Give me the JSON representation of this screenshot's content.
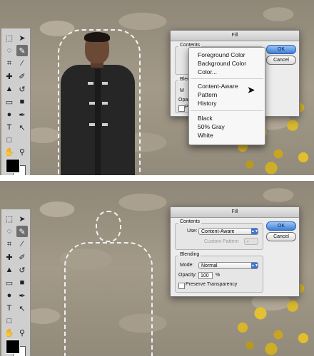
{
  "dialog": {
    "title": "Fill",
    "contents_label": "Contents",
    "use_label": "Use:",
    "use_value": "Content-Aware",
    "custom_pattern_label": "Custom Pattern",
    "blending_label": "Blending",
    "mode_label": "Mode:",
    "mode_value": "Normal",
    "opacity_label": "Opacity:",
    "opacity_value": "100",
    "opacity_unit": "%",
    "preserve_label": "Preserve Transparency",
    "ok_label": "OK",
    "cancel_label": "Cancel"
  },
  "dialog_top_partial": {
    "blending_partial": "Blend",
    "mode_partial": "M",
    "opacity_partial": "Opac",
    "preserve_partial": "Pr"
  },
  "menu": {
    "items": [
      "Foreground Color",
      "Background Color",
      "Color...",
      "Content-Aware",
      "Pattern",
      "History",
      "Black",
      "50% Gray",
      "White"
    ]
  },
  "tools": {
    "icons": [
      "marquee-icon",
      "move-icon",
      "lasso-icon",
      "quick-select-icon",
      "crop-icon",
      "eyedropper-icon",
      "healing-icon",
      "brush-icon",
      "stamp-icon",
      "history-brush-icon",
      "eraser-icon",
      "gradient-icon",
      "dodge-icon",
      "pen-icon",
      "type-icon",
      "path-select-icon",
      "shape-icon",
      "hand-icon",
      "zoom-icon"
    ]
  },
  "colors": {
    "foreground": "#000000",
    "background": "#ffffff",
    "ivy": "#d9b52a",
    "ok_button": "#3f7fd6"
  }
}
